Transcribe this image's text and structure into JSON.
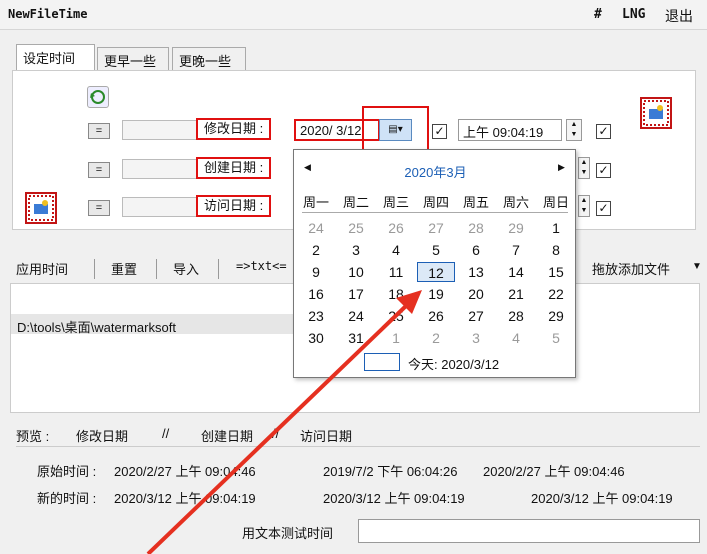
{
  "window": {
    "title": "NewFileTime",
    "menu": [
      "#",
      "LNG",
      "退出"
    ]
  },
  "tabs": [
    "设定时间",
    "更早一些",
    "更晚一些"
  ],
  "rows": [
    {
      "button": "=",
      "label": "修改日期 :"
    },
    {
      "button": "=",
      "label": "创建日期 :"
    },
    {
      "button": "=",
      "label": "访问日期 :"
    }
  ],
  "date_value": "2020/  3/12",
  "time_value": "上午 09:04:19",
  "checkbox_mark": "✓",
  "toolbar": {
    "apply": "应用时间",
    "reset": "重置",
    "import": "导入",
    "export": "=>txt<=",
    "drop": "拖放添加文件",
    "drop_arrow": "▼"
  },
  "file_list": [
    "D:\\tools\\桌面\\watermarksoft"
  ],
  "calendar": {
    "header": "2020年3月",
    "prev": "◀",
    "next": "▶",
    "weekdays": [
      "周一",
      "周二",
      "周三",
      "周四",
      "周五",
      "周六",
      "周日"
    ],
    "weeks": [
      [
        "24",
        "25",
        "26",
        "27",
        "28",
        "29",
        "1"
      ],
      [
        "2",
        "3",
        "4",
        "5",
        "6",
        "7",
        "8"
      ],
      [
        "9",
        "10",
        "11",
        "12",
        "13",
        "14",
        "15"
      ],
      [
        "16",
        "17",
        "18",
        "19",
        "20",
        "21",
        "22"
      ],
      [
        "23",
        "24",
        "25",
        "26",
        "27",
        "28",
        "29"
      ],
      [
        "30",
        "31",
        "1",
        "2",
        "3",
        "4",
        "5"
      ]
    ],
    "selected": "12",
    "today_label": "今天: 2020/3/12"
  },
  "preview": {
    "label": "预览 :",
    "c1": "修改日期",
    "sep": "//",
    "c2": "创建日期",
    "c3": "访问日期"
  },
  "original": {
    "label": "原始时间 :",
    "v1": "2020/2/27 上午 09:04:46",
    "v2": "2019/7/2 下午 06:04:26",
    "v3": "2020/2/27 上午 09:04:46"
  },
  "newtime": {
    "label": "新的时间 :",
    "v1": "2020/3/12 上午 09:04:19",
    "v2": "2020/3/12 上午 09:04:19",
    "v3": "2020/3/12 上午 09:04:19"
  },
  "test_label": "用文本测试时间",
  "colors": {
    "annotation": "#e01010",
    "arrow": "#e53020",
    "calendar_accent": "#1c5fb5"
  }
}
